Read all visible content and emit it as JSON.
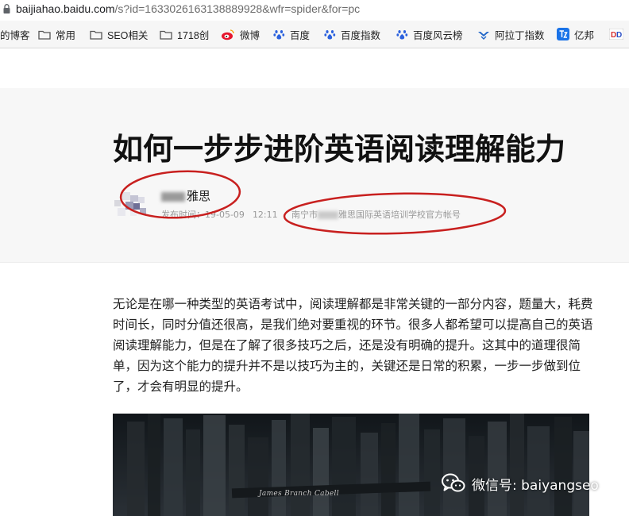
{
  "browser": {
    "url_host": "baijiahao.baidu.com",
    "url_rest": "/s?id=1633026163138889928&wfr=spider&for=pc",
    "bookmarks": [
      {
        "label": "的博客",
        "icon": "none"
      },
      {
        "label": "常用",
        "icon": "folder-icon"
      },
      {
        "label": "SEO相关",
        "icon": "folder-icon"
      },
      {
        "label": "1718创",
        "icon": "folder-icon"
      },
      {
        "label": "微博",
        "icon": "weibo-icon"
      },
      {
        "label": "百度",
        "icon": "baidu-paw-icon"
      },
      {
        "label": "百度指数",
        "icon": "baidu-paw-icon"
      },
      {
        "label": "百度风云榜",
        "icon": "baidu-paw-icon"
      },
      {
        "label": "阿拉丁指数",
        "icon": "aladdin-icon"
      },
      {
        "label": "亿邦",
        "icon": "yibang-icon"
      }
    ]
  },
  "article": {
    "title": "如何一步步进阶英语阅读理解能力",
    "author": "雅思",
    "publish_label": "发布时间：",
    "publish_date": "19-05-09",
    "publish_time": "12:11",
    "source_prefix": "南宁市",
    "source_suffix": "雅思国际英语培训学校官方帐号",
    "paragraph": "无论是在哪一种类型的英语考试中，阅读理解都是非常关键的一部分内容，题量大，耗费时间长，同时分值还很高，是我们绝对要重视的环节。很多人都希望可以提高自己的英语阅读理解能力，但是在了解了很多技巧之后，还是没有明确的提升。这其中的道理很简单，因为这个能力的提升并不是以技巧为主的，关键还是日常的积累，一步一步做到位了，才会有明显的提升。",
    "image_book_spine": "James Branch Cabell"
  },
  "watermark": {
    "text": "微信号: baiyangseo"
  },
  "colors": {
    "annotation_red": "#c8201f",
    "title": "#111111",
    "meta": "#999999",
    "header_bg": "#f7f7f7"
  }
}
